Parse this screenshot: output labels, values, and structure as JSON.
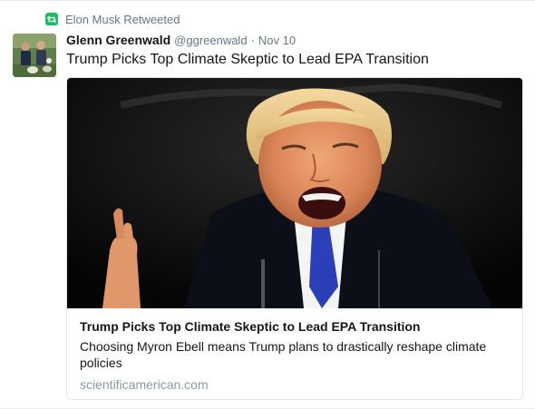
{
  "retweet_context": {
    "icon": "retweet-icon",
    "text": "Elon Musk Retweeted"
  },
  "tweet": {
    "author": {
      "name": "Glenn Greenwald",
      "handle": "@ggreenwald",
      "avatar": "avatar-photo"
    },
    "separator": "·",
    "timestamp": "Nov 10",
    "text": "Trump Picks Top Climate Skeptic to Lead EPA Transition"
  },
  "card": {
    "title": "Trump Picks Top Climate Skeptic to Lead EPA Transition",
    "description": "Choosing Myron Ebell means Trump plans to drastically reshape climate policies",
    "domain": "scientificamerican.com"
  },
  "colors": {
    "retweet_green": "#17bf63",
    "secondary_text": "#657786",
    "domain_text": "#8899a6",
    "border": "#e1e8ed"
  }
}
